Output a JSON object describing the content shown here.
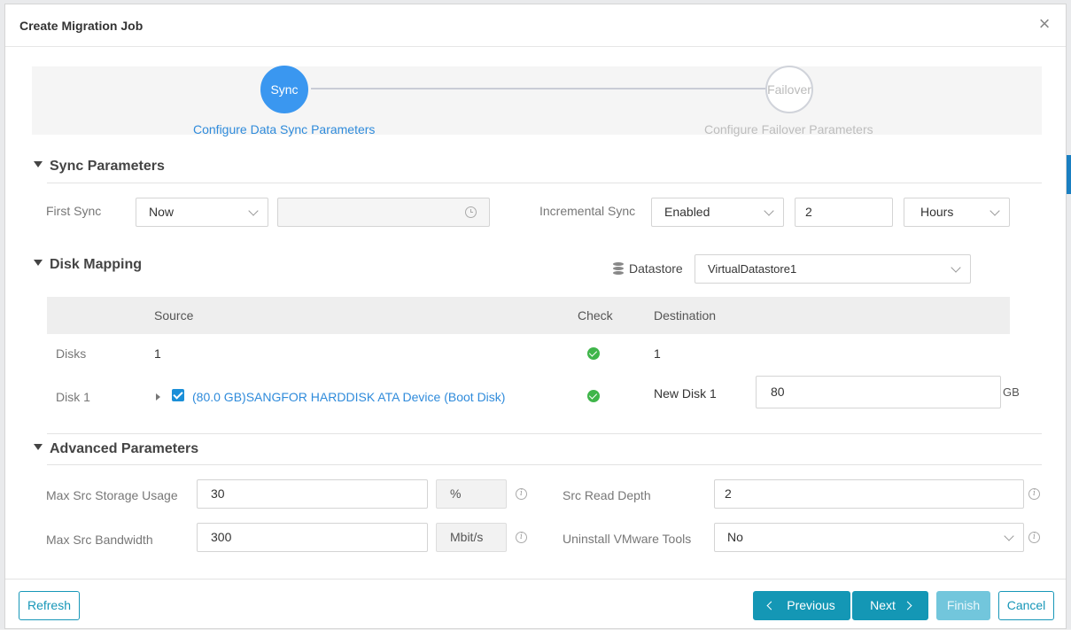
{
  "modal": {
    "title": "Create Migration Job",
    "close_label": "×"
  },
  "steps": [
    {
      "circle": "Sync",
      "label": "Configure Data Sync Parameters",
      "state": "active"
    },
    {
      "circle": "Failover",
      "label": "Configure Failover Parameters",
      "state": "inactive"
    }
  ],
  "sync": {
    "section_title": "Sync Parameters",
    "first_sync_label": "First Sync",
    "first_sync_value": "Now",
    "first_sync_time": "",
    "incremental_label": "Incremental Sync",
    "incremental_value": "Enabled",
    "interval_value": "2",
    "interval_unit": "Hours"
  },
  "disk_mapping": {
    "section_title": "Disk Mapping",
    "datastore_label": "Datastore",
    "datastore_value": "VirtualDatastore1",
    "columns": {
      "source": "Source",
      "check": "Check",
      "destination": "Destination"
    },
    "rows": [
      {
        "name": "Disks",
        "source": "1",
        "destination": "1"
      },
      {
        "name": "Disk 1",
        "source": "(80.0 GB)SANGFOR HARDDISK ATA Device (Boot Disk)",
        "destination": "New Disk 1",
        "size": "80",
        "size_unit": "GB"
      }
    ]
  },
  "advanced": {
    "section_title": "Advanced Parameters",
    "max_storage_label": "Max Src Storage Usage",
    "max_storage_value": "30",
    "max_storage_unit": "%",
    "max_bandwidth_label": "Max Src Bandwidth",
    "max_bandwidth_value": "300",
    "max_bandwidth_unit": "Mbit/s",
    "read_depth_label": "Src Read Depth",
    "read_depth_value": "2",
    "uninstall_label": "Uninstall VMware Tools",
    "uninstall_value": "No"
  },
  "footer": {
    "refresh": "Refresh",
    "previous": "Previous",
    "next": "Next",
    "finish": "Finish",
    "cancel": "Cancel"
  },
  "colors": {
    "primary": "#1497b5",
    "step_active": "#3a97f0",
    "check_ok": "#3fb54a"
  }
}
